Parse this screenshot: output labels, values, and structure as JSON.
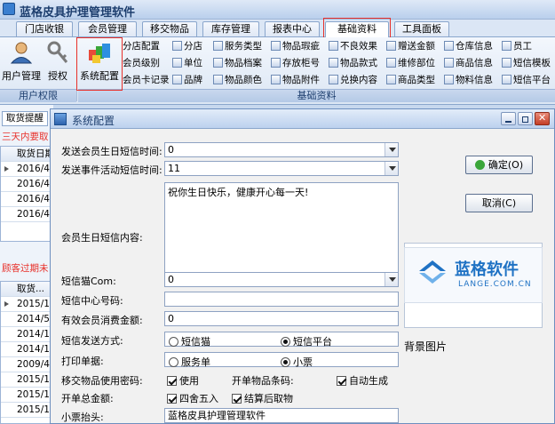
{
  "app": {
    "title": "蓝格皮具护理管理软件"
  },
  "menu_tabs": [
    "门店收银",
    "会员管理",
    "移交物品",
    "库存管理",
    "报表中心",
    "基础资料",
    "工具面板"
  ],
  "ribbon": {
    "user_group_label": "用户权限",
    "basic_group_label": "基础资料",
    "buttons": {
      "user_mgmt": "用户管理",
      "auth": "授权",
      "sys_config": "系统配置"
    },
    "col1": [
      "分店配置",
      "会员级别",
      "会员卡记录"
    ],
    "col2": [
      "分店",
      "单位",
      "品牌"
    ],
    "col3": [
      "服务类型",
      "物品档案",
      "物品颜色"
    ],
    "col4": [
      "物品瑕疵",
      "存放柜号",
      "物品附件"
    ],
    "col5": [
      "不良效果",
      "物品款式",
      "兑换内容"
    ],
    "col6": [
      "赠送金额",
      "维修部位",
      "商品类型"
    ],
    "col7": [
      "仓库信息",
      "商品信息",
      "物料信息"
    ],
    "col8": [
      "员工",
      "短信模板",
      "短信平台"
    ]
  },
  "left": {
    "tab": "取货提醒",
    "red1": "三天内要取",
    "red2": "顾客过期未",
    "grid1_head": "取货日期",
    "grid1_rows": [
      "2016/4/",
      "2016/4/",
      "2016/4/",
      "2016/4/"
    ],
    "grid2_head": "取货...",
    "grid2_rows": [
      "2015/1",
      "2014/5",
      "2014/1",
      "2014/1",
      "2009/4",
      "2015/1",
      "2015/1",
      "2015/1"
    ]
  },
  "dialog": {
    "title": "系统配置",
    "fields": {
      "birthday_sms_time_label": "发送会员生日短信时间:",
      "birthday_sms_time_value": "0",
      "event_sms_time_label": "发送事件活动短信时间:",
      "event_sms_time_value": "11",
      "birthday_sms_content_label": "会员生日短信内容:",
      "birthday_sms_content_value": "祝你生日快乐，健康开心每一天!",
      "sms_cat_com_label": "短信猫Com:",
      "sms_cat_com_value": "0",
      "sms_center_label": "短信中心号码:",
      "sms_center_value": "",
      "min_spend_label": "有效会员消费金额:",
      "min_spend_value": "0",
      "sms_method_label": "短信发送方式:",
      "sms_method_opt1": "短信猫",
      "sms_method_opt2": "短信平台",
      "print_label": "打印单据:",
      "print_opt1": "服务单",
      "print_opt2": "小票",
      "transfer_pwd_label": "移交物品使用密码:",
      "transfer_pwd_check": "使用",
      "order_barcode_label": "开单物品条码:",
      "order_barcode_check": "自动生成",
      "order_total_label": "开单总金额:",
      "round_check": "四舍五入",
      "settle_check": "结算后取物",
      "receipt_header_label": "小票抬头:",
      "receipt_header_value": "蓝格皮具护理管理软件"
    },
    "ok_button": "确定(O)",
    "cancel_button": "取消(C)",
    "logo_main": "蓝格软件",
    "logo_sub": "LANGE.COM.CN",
    "bg_image_label": "背景图片"
  },
  "colors": {
    "accent": "#1f72c4",
    "highlight": "#e8302a",
    "chrome": "#c7d8ee"
  }
}
